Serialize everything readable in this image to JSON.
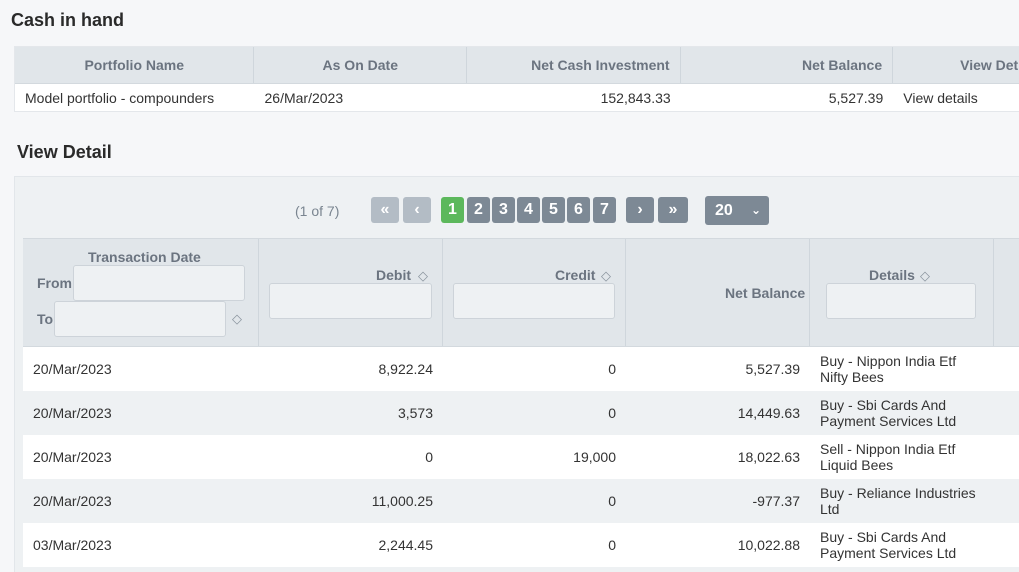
{
  "cash_in_hand": {
    "title": "Cash in hand",
    "headers": [
      "Portfolio Name",
      "As On Date",
      "Net Cash Investment",
      "Net Balance",
      "View Det"
    ],
    "row": {
      "portfolio_name": "Model portfolio - compounders",
      "as_on_date": "26/Mar/2023",
      "net_cash_investment": "152,843.33",
      "net_balance": "5,527.39",
      "view_link": "View details"
    }
  },
  "view_detail": {
    "title": "View Detail",
    "paginator": {
      "info": "(1 of 7)",
      "first": "«",
      "prev": "‹",
      "pages": [
        "1",
        "2",
        "3",
        "4",
        "5",
        "6",
        "7"
      ],
      "next": "›",
      "last": "»",
      "rows_per_page": "20"
    },
    "headers": {
      "date": "Transaction Date",
      "from": "From:",
      "to": "To:",
      "debit": "Debit",
      "credit": "Credit",
      "net_balance": "Net Balance",
      "details": "Details"
    },
    "rows": [
      {
        "date": "20/Mar/2023",
        "debit": "8,922.24",
        "credit": "0",
        "net_balance": "5,527.39",
        "details": "Buy - Nippon India Etf Nifty Bees"
      },
      {
        "date": "20/Mar/2023",
        "debit": "3,573",
        "credit": "0",
        "net_balance": "14,449.63",
        "details": "Buy - Sbi Cards And Payment Services Ltd"
      },
      {
        "date": "20/Mar/2023",
        "debit": "0",
        "credit": "19,000",
        "net_balance": "18,022.63",
        "details": "Sell - Nippon India Etf Liquid Bees"
      },
      {
        "date": "20/Mar/2023",
        "debit": "11,000.25",
        "credit": "0",
        "net_balance": "-977.37",
        "details": "Buy - Reliance Industries Ltd"
      },
      {
        "date": "03/Mar/2023",
        "debit": "2,244.45",
        "credit": "0",
        "net_balance": "10,022.88",
        "details": "Buy - Sbi Cards And Payment Services Ltd"
      }
    ]
  }
}
